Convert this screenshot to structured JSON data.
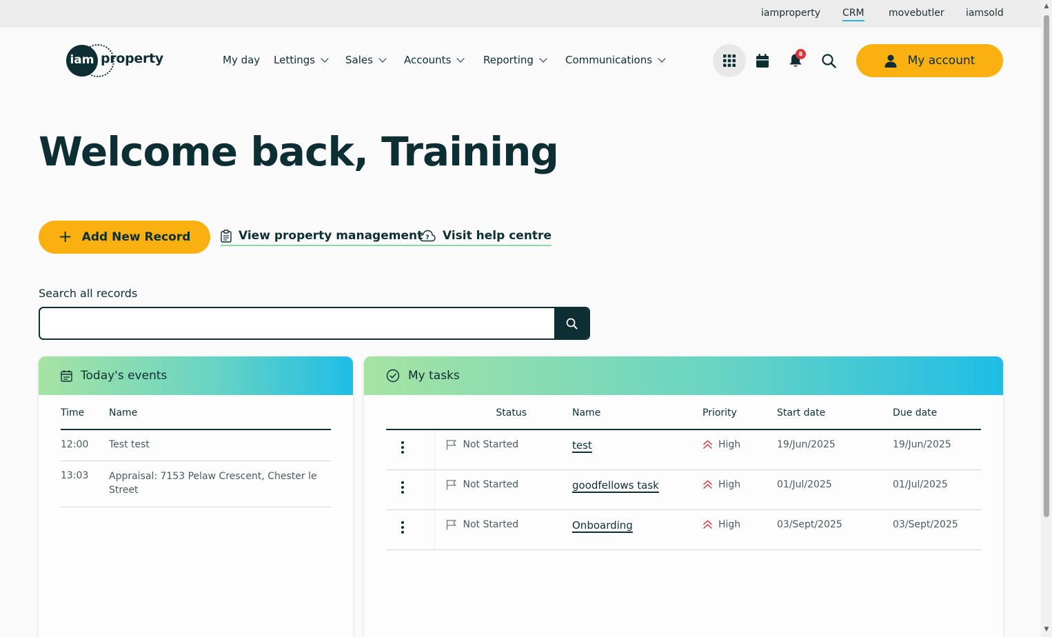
{
  "util_nav": [
    "iamproperty",
    "CRM",
    "movebutler",
    "iamsold"
  ],
  "logo": {
    "mark": "iam",
    "word": "property"
  },
  "nav": [
    "My day",
    "Lettings",
    "Sales",
    "Accounts",
    "Reporting",
    "Communications"
  ],
  "notifications_count": "8",
  "account_label": "My account",
  "title": "Welcome back, Training",
  "actions": {
    "add": "Add New Record",
    "property": "View property management",
    "help": "Visit help centre"
  },
  "search": {
    "label": "Search all records",
    "value": ""
  },
  "events": {
    "title": "Today's events",
    "columns": [
      "Time",
      "Name"
    ],
    "rows": [
      {
        "time": "12:00",
        "name": "Test test"
      },
      {
        "time": "13:03",
        "name": "Appraisal: 7153 Pelaw Crescent, Chester le Street"
      }
    ]
  },
  "tasks": {
    "title": "My tasks",
    "columns": [
      "Status",
      "Name",
      "Priority",
      "Start date",
      "Due date"
    ],
    "rows": [
      {
        "status": "Not Started",
        "name": "test",
        "priority": "High",
        "start": "19/Jun/2025",
        "due": "19/Jun/2025"
      },
      {
        "status": "Not Started",
        "name": "goodfellows task",
        "priority": "High",
        "start": "01/Jul/2025",
        "due": "01/Jul/2025"
      },
      {
        "status": "Not Started",
        "name": "Onboarding",
        "priority": "High",
        "start": "03/Sept/2025",
        "due": "03/Sept/2025"
      }
    ]
  },
  "colors": {
    "accent": "#fbb012",
    "dark": "#0d2e33",
    "priority_high": "#d8363a"
  }
}
